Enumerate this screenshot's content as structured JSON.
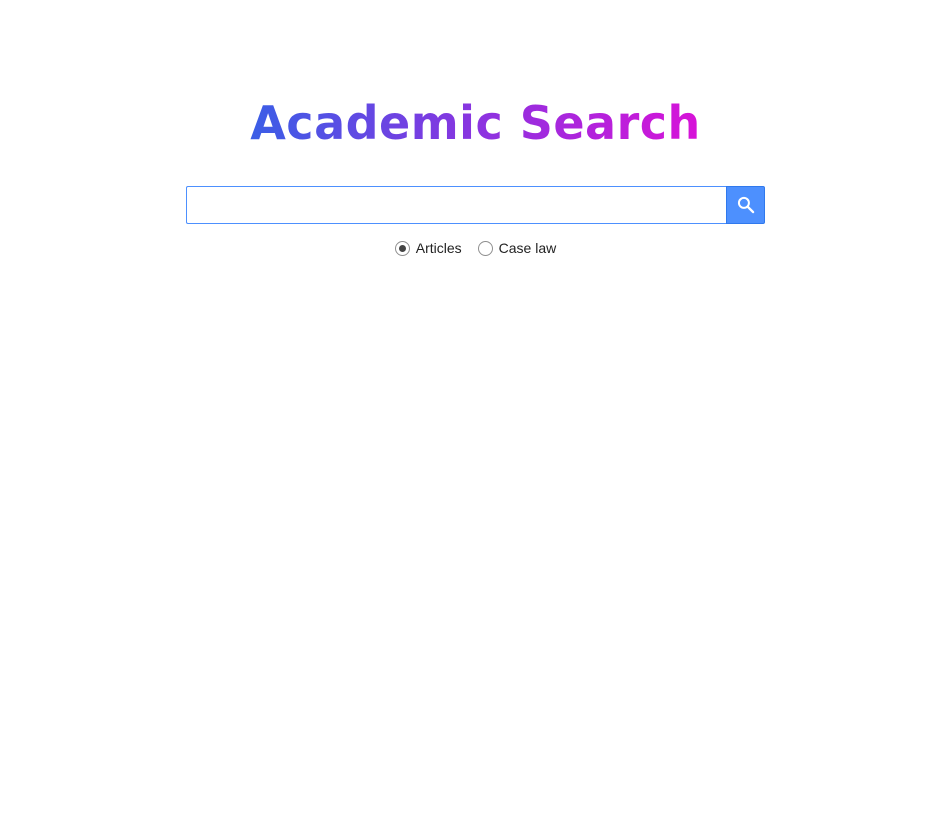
{
  "logo": {
    "text": "Academic Search",
    "gradient_start": "#3a5ee6",
    "gradient_end": "#d812d8"
  },
  "search": {
    "value": "",
    "placeholder": "",
    "button_icon": "search-icon",
    "button_color": "#4d90fe"
  },
  "search_type": {
    "selected": "Articles",
    "options": [
      {
        "label": "Articles",
        "checked": true
      },
      {
        "label": "Case law",
        "checked": false
      }
    ]
  }
}
